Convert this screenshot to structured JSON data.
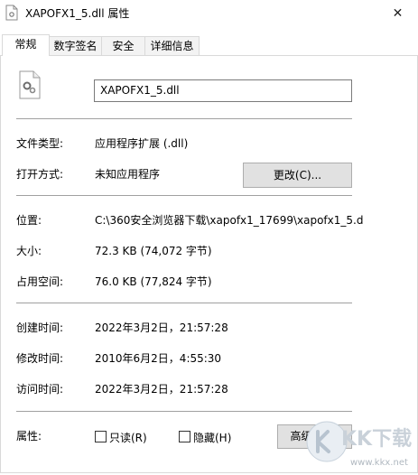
{
  "window": {
    "title": "XAPOFX1_5.dll 属性",
    "close_glyph": "✕"
  },
  "tabs": [
    {
      "label": "常规"
    },
    {
      "label": "数字签名"
    },
    {
      "label": "安全"
    },
    {
      "label": "详细信息"
    }
  ],
  "general": {
    "filename": "XAPOFX1_5.dll",
    "file_type_label": "文件类型:",
    "file_type_value": "应用程序扩展 (.dll)",
    "opens_with_label": "打开方式:",
    "opens_with_value": "未知应用程序",
    "change_button": "更改(C)...",
    "location_label": "位置:",
    "location_value": "C:\\360安全浏览器下载\\xapofx1_17699\\xapofx1_5.d",
    "size_label": "大小:",
    "size_value": "72.3 KB (74,072 字节)",
    "size_on_disk_label": "占用空间:",
    "size_on_disk_value": "76.0 KB (77,824 字节)",
    "created_label": "创建时间:",
    "created_value": "2022年3月2日，21:57:28",
    "modified_label": "修改时间:",
    "modified_value": "2010年6月2日，4:55:30",
    "accessed_label": "访问时间:",
    "accessed_value": "2022年3月2日，21:57:28",
    "attributes_label": "属性:",
    "readonly_label": "只读(R)",
    "readonly_checked": false,
    "hidden_label": "隐藏(H)",
    "hidden_checked": false,
    "advanced_button": "高级(D)..."
  },
  "watermark": {
    "text": "KK下载",
    "url": "www.kkx.net"
  }
}
